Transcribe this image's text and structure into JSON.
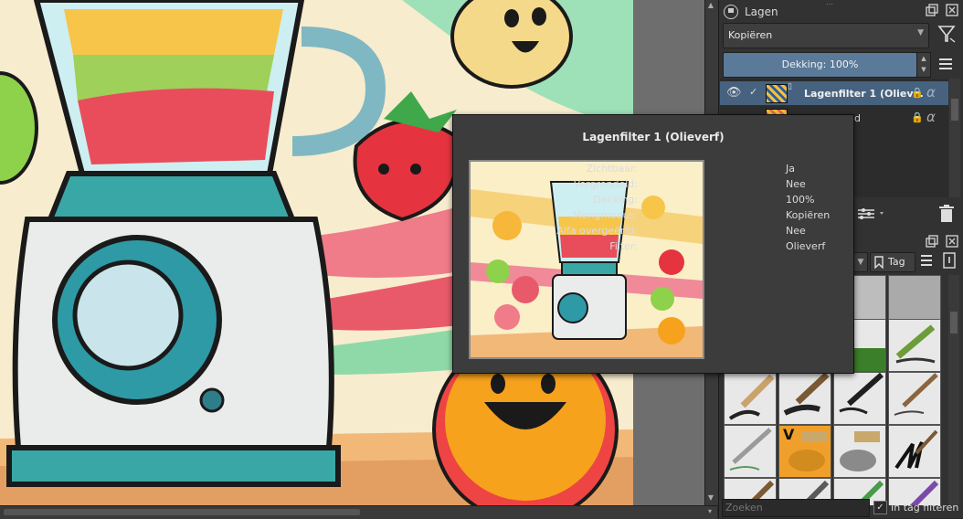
{
  "layers_docker": {
    "title": "Lagen",
    "blend_mode": "Kopiëren",
    "opacity_label": "Dekking:",
    "opacity_value": "100%",
    "layers": [
      {
        "name": "Lagenfilter 1 (Oliev…",
        "selected": true
      },
      {
        "name": "nd",
        "selected": false
      }
    ]
  },
  "tooltip": {
    "title": "Lagenfilter 1 (Olieverf)",
    "rows": [
      {
        "label": "Zichtbaar:",
        "value": "Ja"
      },
      {
        "label": "Vergrendeld:",
        "value": "Nee"
      },
      {
        "label": "Dekking:",
        "value": "100%"
      },
      {
        "label": "Mengmodus:",
        "value": "Kopiëren"
      },
      {
        "label": "Alfa overgeërfd:",
        "value": "Nee"
      },
      {
        "label": "Filter:",
        "value": "Olieverf"
      }
    ]
  },
  "brush_docker": {
    "tag_label": "Tag",
    "search_placeholder": "Zoeken",
    "filter_in_tag_label": "In tag filteren"
  },
  "colors": {
    "accent": "#5b7a99",
    "selected_row": "#46627f",
    "panel": "#323232"
  }
}
